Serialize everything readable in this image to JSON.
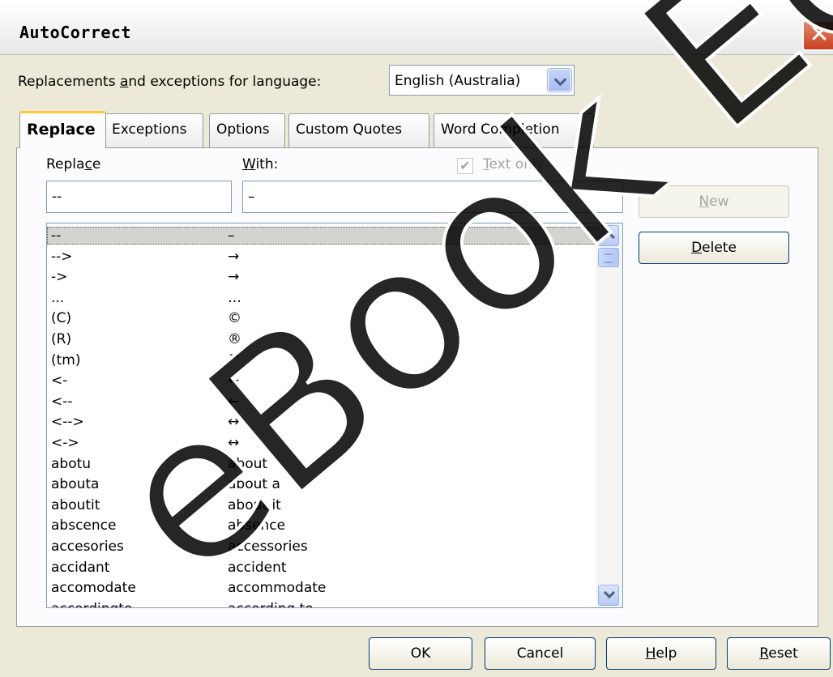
{
  "window": {
    "title": "AutoCorrect",
    "close_glyph": "✕"
  },
  "language": {
    "label_parts": [
      "Replacements ",
      "a",
      "nd exceptions for language:"
    ],
    "value": "English (Australia)"
  },
  "tabs": [
    "Replace",
    "Exceptions",
    "Options",
    "Custom Quotes",
    "Word Completion"
  ],
  "replace": {
    "col_replace_parts": [
      "Repla",
      "c",
      "e"
    ],
    "col_with_parts": [
      "",
      "W",
      "ith:"
    ],
    "text_only_parts": [
      "",
      "T",
      "ext only"
    ],
    "text_only_checked": true,
    "replace_value": "--",
    "with_value": "–",
    "buttons": {
      "new_parts": [
        "",
        "N",
        "ew"
      ],
      "delete_parts": [
        "",
        "D",
        "elete"
      ]
    },
    "entries": [
      {
        "r": "--",
        "w": "–"
      },
      {
        "r": "-->",
        "w": "→"
      },
      {
        "r": "->",
        "w": "→"
      },
      {
        "r": "...",
        "w": "…"
      },
      {
        "r": "(C)",
        "w": "©"
      },
      {
        "r": "(R)",
        "w": "®"
      },
      {
        "r": "(tm)",
        "w": "™"
      },
      {
        "r": "<-",
        "w": "←"
      },
      {
        "r": "<--",
        "w": "←"
      },
      {
        "r": "<-->",
        "w": "↔"
      },
      {
        "r": "<->",
        "w": "↔"
      },
      {
        "r": "abotu",
        "w": "about"
      },
      {
        "r": "abouta",
        "w": "about a"
      },
      {
        "r": "aboutit",
        "w": "about it"
      },
      {
        "r": "abscence",
        "w": "absence"
      },
      {
        "r": "accesories",
        "w": "accessories"
      },
      {
        "r": "accidant",
        "w": "accident"
      },
      {
        "r": "accomodate",
        "w": "accommodate"
      },
      {
        "r": "accordingto",
        "w": "according to"
      }
    ]
  },
  "footer": {
    "ok": "OK",
    "cancel": "Cancel",
    "help_parts": [
      "",
      "H",
      "elp"
    ],
    "reset_parts": [
      "",
      "R",
      "eset"
    ]
  },
  "watermark": "eBook Edition"
}
